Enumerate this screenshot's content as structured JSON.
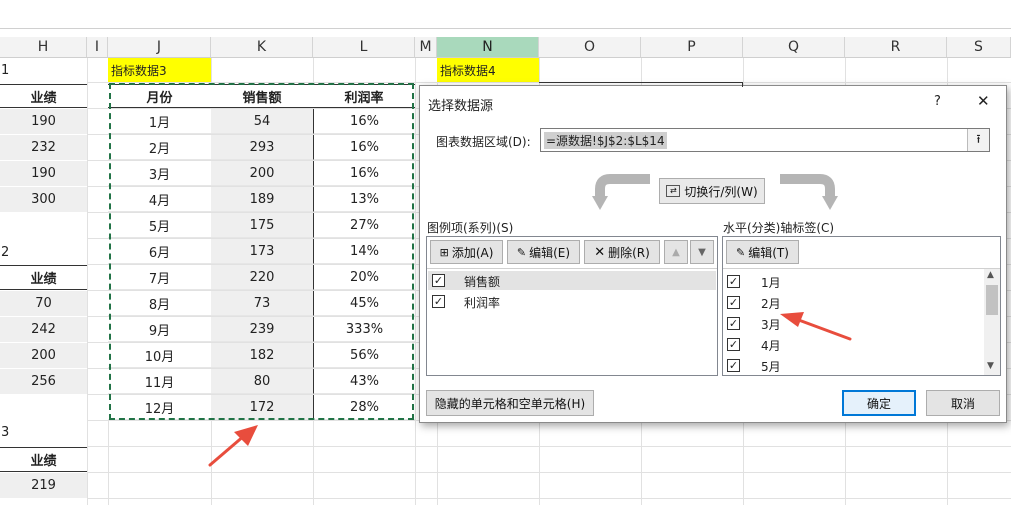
{
  "columns": {
    "H": "H",
    "I": "I",
    "J": "J",
    "K": "K",
    "L": "L",
    "M": "M",
    "N": "N",
    "O": "O",
    "P": "P",
    "Q": "Q",
    "R": "R",
    "S": "S"
  },
  "left_col": {
    "row_1": "1",
    "header_1": "业绩",
    "values_1": [
      "190",
      "232",
      "190",
      "300"
    ],
    "row_2": "2",
    "header_2": "业绩",
    "values_2": [
      "70",
      "242",
      "200",
      "256"
    ],
    "row_3": "3",
    "header_3": "业绩",
    "values_3": [
      "219"
    ]
  },
  "table": {
    "title": "指标数据3",
    "title4": "指标数据4",
    "headers": [
      "月份",
      "销售额",
      "利润率"
    ],
    "rows": [
      [
        "1月",
        "54",
        "16%"
      ],
      [
        "2月",
        "293",
        "16%"
      ],
      [
        "3月",
        "200",
        "16%"
      ],
      [
        "4月",
        "189",
        "13%"
      ],
      [
        "5月",
        "175",
        "27%"
      ],
      [
        "6月",
        "173",
        "14%"
      ],
      [
        "7月",
        "220",
        "20%"
      ],
      [
        "8月",
        "73",
        "45%"
      ],
      [
        "9月",
        "239",
        "333%"
      ],
      [
        "10月",
        "182",
        "56%"
      ],
      [
        "11月",
        "80",
        "43%"
      ],
      [
        "12月",
        "172",
        "28%"
      ]
    ]
  },
  "dialog": {
    "title": "选择数据源",
    "help": "?",
    "close": "✕",
    "range_label": "图表数据区域(D):",
    "range_value": "=源数据!$J$2:$L$14",
    "switch_label": "切换行/列(W)",
    "legend_label": "图例项(系列)(S)",
    "axis_label": "水平(分类)轴标签(C)",
    "add_label": "添加(A)",
    "edit_label": "编辑(E)",
    "delete_label": "删除(R)",
    "axis_edit_label": "编辑(T)",
    "series": [
      "销售额",
      "利润率"
    ],
    "categories": [
      "1月",
      "2月",
      "3月",
      "4月",
      "5月"
    ],
    "hidden_cells": "隐藏的单元格和空单元格(H)",
    "ok": "确定",
    "cancel": "取消"
  },
  "colors": {
    "selection_border": "#217346",
    "arrow": "#e84d3d",
    "highlight": "#ffff00",
    "col_selected": "#a9d9bc"
  },
  "icons": [
    "upload-icon",
    "switch-icon",
    "add-icon",
    "edit-icon",
    "delete-icon",
    "up-arrow-icon",
    "down-arrow-icon",
    "check-icon",
    "scroll-up-icon",
    "scroll-down-icon",
    "close-icon",
    "help-icon"
  ]
}
